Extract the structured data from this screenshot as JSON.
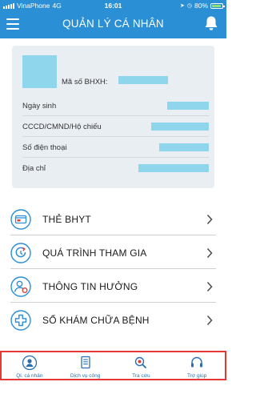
{
  "status_bar": {
    "carrier": "VinaPhone",
    "network": "4G",
    "time": "16:01",
    "battery": "80%"
  },
  "header": {
    "title": "QUẢN LÝ CÁ NHÂN",
    "menu_icon": "hamburger-menu-icon",
    "bell_icon": "bell-icon"
  },
  "profile": {
    "bhxh_label": "Mã số BHXH:",
    "fields": [
      {
        "label": "Ngày sinh"
      },
      {
        "label": "CCCD/CMND/Hộ chiếu"
      },
      {
        "label": "Số điện thoại"
      },
      {
        "label": "Địa chỉ"
      }
    ]
  },
  "menu": [
    {
      "label": "THẺ BHYT",
      "icon": "health-card-icon"
    },
    {
      "label": "QUÁ TRÌNH THAM GIA",
      "icon": "history-refresh-icon"
    },
    {
      "label": "THÔNG TIN HƯỞNG",
      "icon": "person-benefit-icon"
    },
    {
      "label": "SỔ KHÁM CHỮA BỆNH",
      "icon": "medical-cross-icon"
    }
  ],
  "bottom_nav": [
    {
      "label": "Ql. cá nhân",
      "icon": "personal-icon"
    },
    {
      "label": "Dịch vụ công",
      "icon": "document-icon"
    },
    {
      "label": "Tra cứu",
      "icon": "search-icon"
    },
    {
      "label": "Trợ giúp",
      "icon": "headset-icon"
    }
  ],
  "colors": {
    "primary": "#2b8fd6",
    "card_bg": "#e9eef3",
    "redacted": "#8fd6ec",
    "highlight_border": "#e53935"
  }
}
